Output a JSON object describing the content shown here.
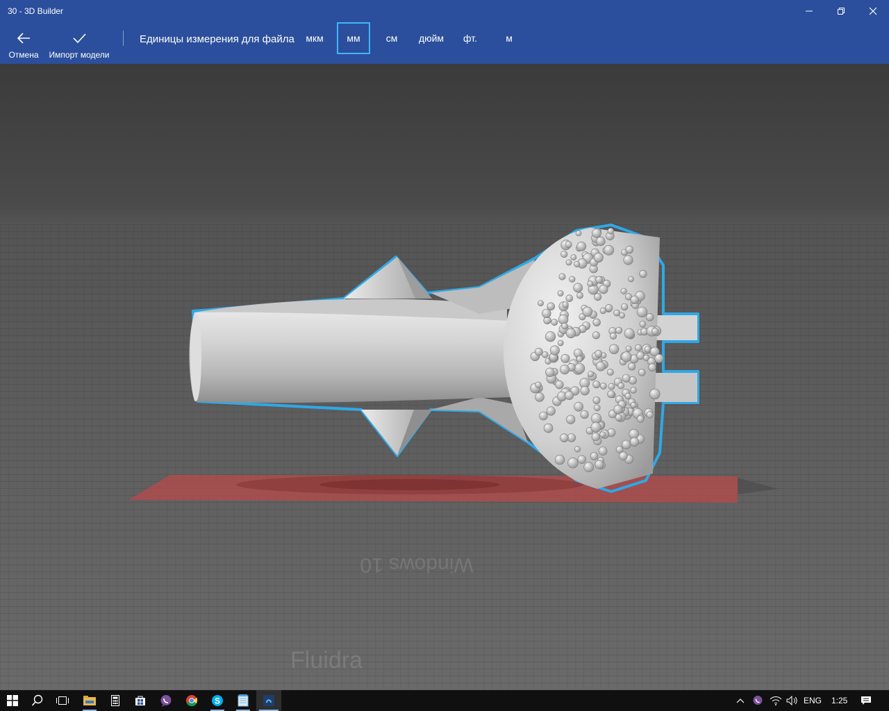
{
  "window": {
    "title": "30 - 3D Builder"
  },
  "toolbar": {
    "cancel_label": "Отмена",
    "import_label": "Импорт модели",
    "units_label": "Единицы измерения для файла",
    "units": [
      "мкм",
      "мм",
      "см",
      "дюйм",
      "фт.",
      "м"
    ],
    "selected_unit": "мм"
  },
  "viewport": {
    "platform_label": "Windows 10",
    "model_label": "Fluidra",
    "selection_outline_color": "#2fa8e6",
    "shadow_color": "#b84a4a"
  },
  "taskbar": {
    "language": "ENG",
    "clock": "1:25",
    "apps": [
      "file-explorer",
      "calculator",
      "store",
      "viber",
      "chrome",
      "skype",
      "notepad",
      "3d-builder"
    ]
  },
  "colors": {
    "accent": "#2b4f9c",
    "selected_unit_border": "#3fb6ff"
  }
}
